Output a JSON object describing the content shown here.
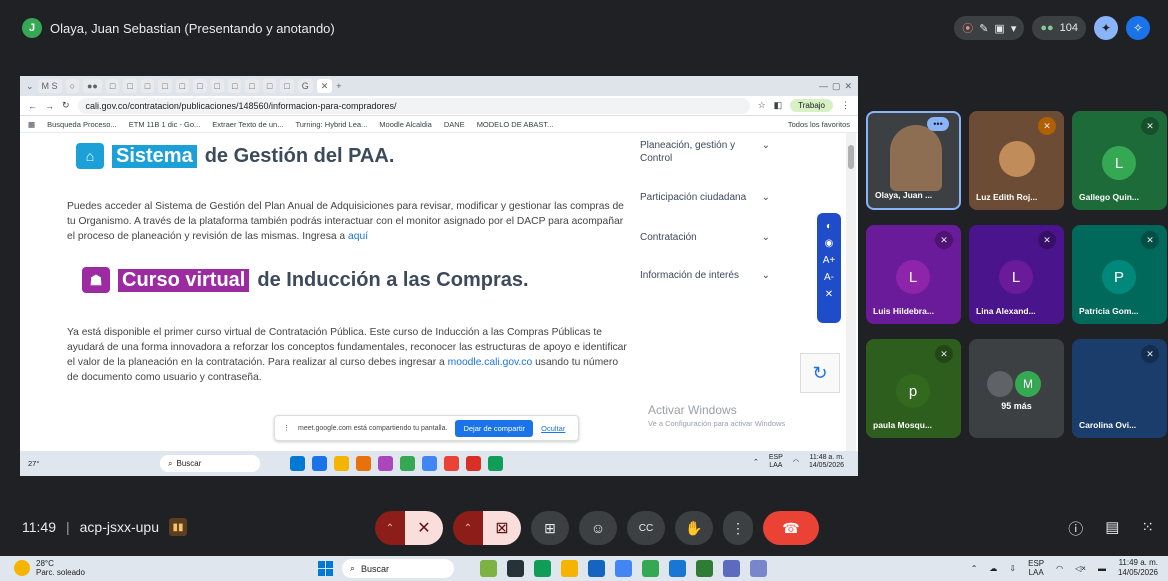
{
  "meet": {
    "presenter_initial": "J",
    "presenter_label": "Olaya, Juan Sebastian (Presentando y anotando)",
    "participants_count": "104",
    "meeting_time": "11:49",
    "meeting_code": "acp-jsxx-upu"
  },
  "browser": {
    "url": "cali.gov.co/contratacion/publicaciones/148560/informacion-para-compradores/",
    "profile": "Trabajo",
    "bookmarks": [
      "Busqueda Proceso...",
      "ETM 11B 1 dic - Go...",
      "Extraer Texto de un...",
      "Turning: Hybrid Lea...",
      "Moodle Alcaldia",
      "DANE",
      "MODELO DE ABAST..."
    ],
    "all_favorites": "Todos los favoritos"
  },
  "page": {
    "sec1_highlight": "Sistema",
    "sec1_rest": "de Gestión del PAA.",
    "sec1_text": "Puedes acceder al Sistema de Gestión del Plan Anual de Adquisiciones para revisar, modificar y gestionar las compras de tu Organismo. A través de la plataforma también podrás interactuar con el monitor asignado por el DACP para acompañar el proceso de planeación y revisión de las mismas. Ingresa a",
    "sec1_link": "aquí",
    "sec2_highlight": "Curso virtual",
    "sec2_rest": "de Inducción a las Compras.",
    "sec2_text_a": "Ya está disponible el primer curso virtual de Contratación Pública. Este curso de Inducción a las Compras Públicas te ayudará de una forma innovadora a reforzar los conceptos fundamentales, reconocer las estructuras de apoyo e identificar el valor de la planeación en la contratación. Para realizar al curso debes ingresar a",
    "sec2_link": "moodle.cali.gov.co",
    "sec2_text_b": "usando tu número de documento como usuario y contraseña.",
    "side_menu": [
      "Planeación, gestión y Control",
      "Participación ciudadana",
      "Contratación",
      "Información de interés"
    ],
    "activate_title": "Activar Windows",
    "activate_sub": "Ve a Configuración para activar Windows",
    "share_text": "meet.google.com está compartiendo tu pantalla.",
    "share_stop": "Dejar de compartir",
    "share_hide": "Ocultar"
  },
  "inner_taskbar": {
    "temp": "27°",
    "search": "Buscar",
    "lang": "ESP",
    "lang2": "LAA",
    "time": "11:48 a. m.",
    "date": "14/05/2026"
  },
  "tiles": [
    {
      "name": "Olaya, Juan ...",
      "color": "#3c4043",
      "initial": ""
    },
    {
      "name": "Luz Edith Roj...",
      "color": "#6d4c35",
      "initial": ""
    },
    {
      "name": "Gallego Quin...",
      "color": "#1e6b3a",
      "initial": "L"
    },
    {
      "name": "Luis Hildebra...",
      "color": "#6a1b9a",
      "initial": "L"
    },
    {
      "name": "Lina Alexand...",
      "color": "#4a148c",
      "initial": "L"
    },
    {
      "name": "Patricia Gom...",
      "color": "#00695c",
      "initial": "P"
    },
    {
      "name": "paula Mosqu...",
      "color": "#2e5e1e",
      "initial": "p"
    },
    {
      "name": "95 más",
      "color": "#3c4043",
      "initial": "M"
    },
    {
      "name": "Carolina Ovi...",
      "color": "#1a3d6b",
      "initial": ""
    }
  ],
  "win_taskbar": {
    "temp": "28°C",
    "weather": "Parc. soleado",
    "search": "Buscar",
    "lang": "ESP",
    "lang2": "LAA",
    "time": "11:49 a. m.",
    "date": "14/05/2026"
  }
}
